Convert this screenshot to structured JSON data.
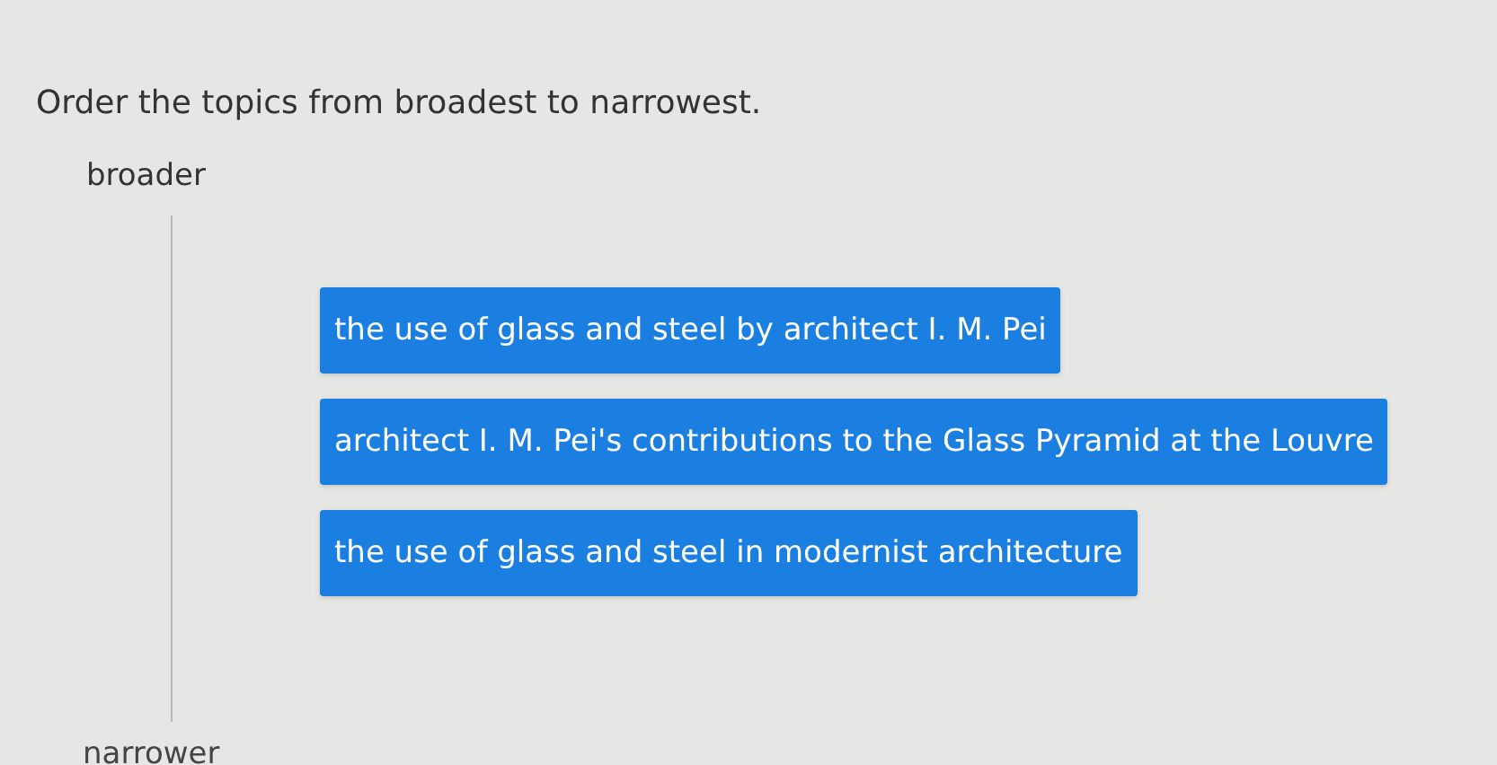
{
  "instruction": "Order the topics from broadest to narrowest.",
  "top_label": "broader",
  "items": [
    {
      "text": "the use of glass and steel by architect I. M. Pei"
    },
    {
      "text": "architect I. M. Pei's contributions to the Glass Pyramid at the Louvre"
    },
    {
      "text": "the use of glass and steel in modernist architecture"
    }
  ],
  "bottom_label": "narrower"
}
